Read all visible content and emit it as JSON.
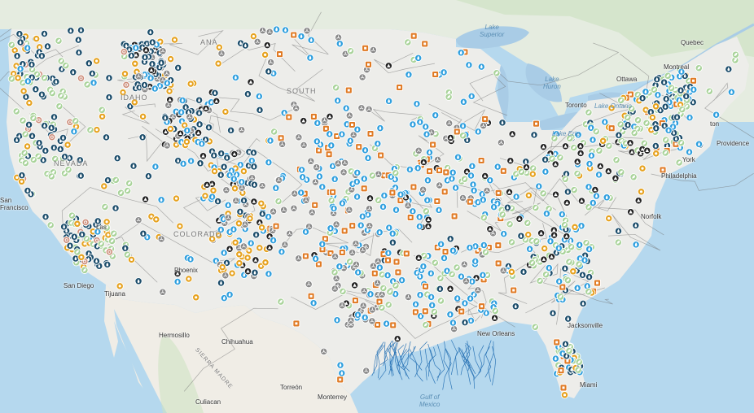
{
  "map": {
    "colors": {
      "ocean": "#b5d8ee",
      "land": "#ededea",
      "canada": "#e5ece0",
      "mexico": "#f0ede6",
      "green_areas": "#cfe3c3",
      "lakes": "#a9cce6",
      "pipelines": "#6f6f6f",
      "gulf_lines": "#2e77b8"
    },
    "icon_types": [
      {
        "name": "natural-gas-marker",
        "color": "#2f9fde",
        "glyph": "flame"
      },
      {
        "name": "coal-marker",
        "color": "#222222",
        "glyph": "triangle"
      },
      {
        "name": "hydro-marker",
        "color": "#1c4d6b",
        "glyph": "drop"
      },
      {
        "name": "solar-marker",
        "color": "#e6a21f",
        "glyph": "sun"
      },
      {
        "name": "biomass-marker",
        "color": "#a9d39a",
        "glyph": "leaf"
      },
      {
        "name": "wind-marker",
        "color": "#8a8a8a",
        "glyph": "turbine"
      },
      {
        "name": "petroleum-marker",
        "color": "#e07a24",
        "glyph": "square"
      },
      {
        "name": "geothermal-marker",
        "color": "#cd8d7a",
        "glyph": "ring"
      }
    ],
    "labels": {
      "quebec": "Quebec",
      "montreal": "Montreal",
      "ottawa": "Ottawa",
      "toronto": "Toronto",
      "lake_superior": "Lake\nSuperior",
      "lake_huron": "Lake\nHuron",
      "lake_ontario": "Lake Ontario",
      "lake_erie": "Lake Erie",
      "idaho": "IDAHO",
      "south_dakota": "SOUTH",
      "montana": "ANA",
      "colorado": "COLORADO",
      "nevada": "NEVADA",
      "san_francisco": "San\nFrancisco",
      "san_diego": "San Diego",
      "tijuana": "Tijuana",
      "las_vegas": "Las",
      "phoenix": "Phoenix",
      "hermosillo": "Hermosillo",
      "chihuahua": "Chihuahua",
      "torreon": "Torreón",
      "monterrey": "Monterrey",
      "culiacan": "Culiacan",
      "sierra_madre": "SIERRA MADRE",
      "gulf_of_mexico": "Gulf of\nMexico",
      "new_orleans": "New Orleans",
      "jacksonville": "Jacksonville",
      "miami": "Miami",
      "philadelphia": "Philadelphia",
      "norfolk": "Norfolk",
      "new_york": "York",
      "boston": "ton",
      "providence": "Providence"
    }
  }
}
